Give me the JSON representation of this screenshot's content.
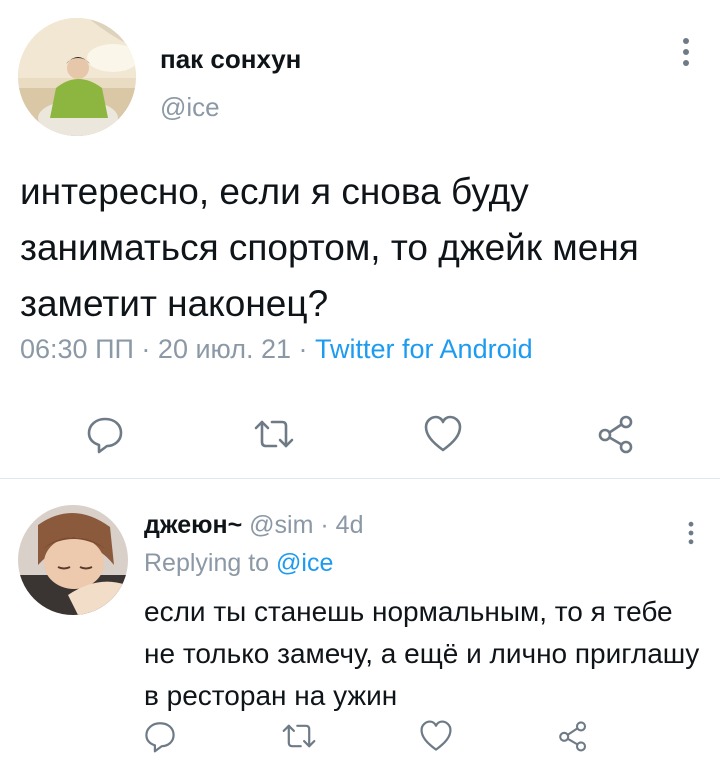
{
  "tweet": {
    "author_name": "пак сонхун",
    "author_handle": "@ice",
    "text": "интересно, если я снова буду заниматься спортом, то джейк меня заметит наконец?",
    "time": "06:30 ПП",
    "separator": "·",
    "date": "20 июл. 21",
    "source": "Twitter for Android",
    "actions": [
      "reply-icon",
      "retweet-icon",
      "like-icon",
      "share-icon"
    ]
  },
  "reply": {
    "author_name": "джеюн~",
    "author_handle": "@sim",
    "separator": "·",
    "age": "4d",
    "replying_label": "Replying to",
    "replying_mention": "@ice",
    "text": "если ты станешь нормальным, то я тебе не только замечу, а ещё и лично приглашу в ресторан на ужин",
    "actions": [
      "reply-icon",
      "retweet-icon",
      "like-icon",
      "share-icon"
    ]
  },
  "colors": {
    "text": "#0f1419",
    "secondary": "#8b98a5",
    "accent": "#1d9bf0",
    "icon": "#6e7b87",
    "divider": "#e1e8ed"
  }
}
